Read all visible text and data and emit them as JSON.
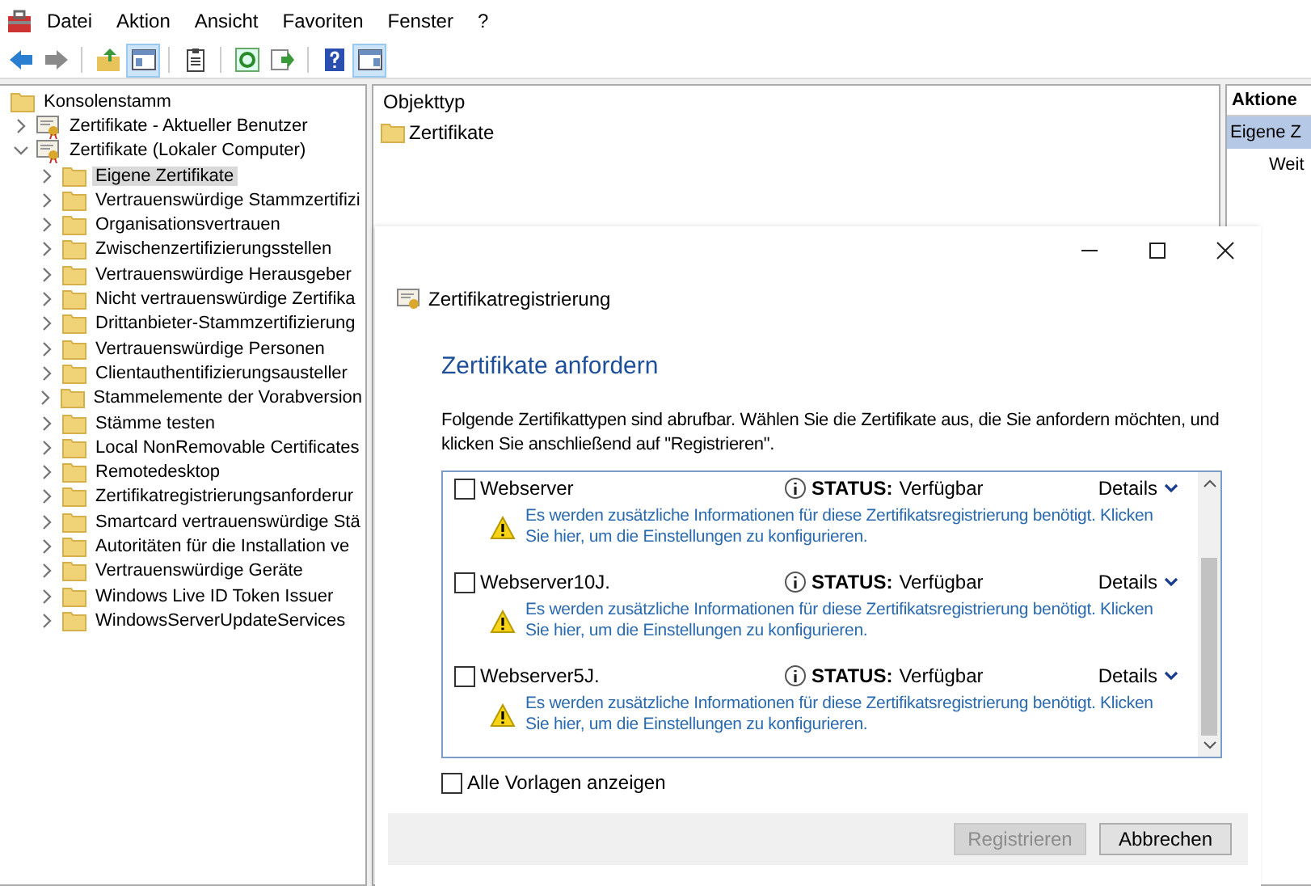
{
  "menu": [
    "Datei",
    "Aktion",
    "Ansicht",
    "Favoriten",
    "Fenster",
    "?"
  ],
  "toolbar": [
    [
      {
        "kind": "back",
        "pressed": false
      },
      {
        "kind": "forward",
        "pressed": false
      }
    ],
    [
      {
        "kind": "up",
        "pressed": false
      },
      {
        "kind": "tree",
        "pressed": true
      }
    ],
    [
      {
        "kind": "clipboard",
        "pressed": false
      }
    ],
    [
      {
        "kind": "refresh",
        "pressed": false
      },
      {
        "kind": "export",
        "pressed": false
      }
    ],
    [
      {
        "kind": "help",
        "pressed": false
      },
      {
        "kind": "actions",
        "pressed": true
      }
    ]
  ],
  "tree": [
    {
      "label": "Konsolenstamm",
      "kind": "root",
      "selected": false,
      "children": [
        {
          "label": "Zertifikate - Aktueller Benutzer",
          "kind": "store",
          "selected": false,
          "expanded": false
        },
        {
          "label": "Zertifikate (Lokaler Computer)",
          "kind": "store",
          "selected": false,
          "expanded": true,
          "children": [
            {
              "label": "Eigene Zertifikate",
              "kind": "folder",
              "selected": true,
              "expanded": false
            },
            {
              "label": "Vertrauenswürdige Stammzertifizi",
              "kind": "folder",
              "selected": false,
              "expanded": false
            },
            {
              "label": "Organisationsvertrauen",
              "kind": "folder",
              "selected": false,
              "expanded": false
            },
            {
              "label": "Zwischenzertifizierungsstellen",
              "kind": "folder",
              "selected": false,
              "expanded": false
            },
            {
              "label": "Vertrauenswürdige Herausgeber",
              "kind": "folder",
              "selected": false,
              "expanded": false
            },
            {
              "label": "Nicht vertrauenswürdige Zertifika",
              "kind": "folder",
              "selected": false,
              "expanded": false
            },
            {
              "label": "Drittanbieter-Stammzertifizierung",
              "kind": "folder",
              "selected": false,
              "expanded": false
            },
            {
              "label": "Vertrauenswürdige Personen",
              "kind": "folder",
              "selected": false,
              "expanded": false
            },
            {
              "label": "Clientauthentifizierungsausteller",
              "kind": "folder",
              "selected": false,
              "expanded": false
            },
            {
              "label": "Stammelemente der Vorabversion",
              "kind": "folder",
              "selected": false,
              "expanded": false
            },
            {
              "label": "Stämme testen",
              "kind": "folder",
              "selected": false,
              "expanded": false
            },
            {
              "label": "Local NonRemovable Certificates",
              "kind": "folder",
              "selected": false,
              "expanded": false
            },
            {
              "label": "Remotedesktop",
              "kind": "folder",
              "selected": false,
              "expanded": false
            },
            {
              "label": "Zertifikatregistrierungsanforderur",
              "kind": "folder",
              "selected": false,
              "expanded": false
            },
            {
              "label": "Smartcard vertrauenswürdige Stä",
              "kind": "folder",
              "selected": false,
              "expanded": false
            },
            {
              "label": "Autoritäten für die Installation ve",
              "kind": "folder",
              "selected": false,
              "expanded": false
            },
            {
              "label": "Vertrauenswürdige Geräte",
              "kind": "folder",
              "selected": false,
              "expanded": false
            },
            {
              "label": "Windows Live ID Token Issuer",
              "kind": "folder",
              "selected": false,
              "expanded": false
            },
            {
              "label": "WindowsServerUpdateServices",
              "kind": "folder",
              "selected": false,
              "expanded": false
            }
          ]
        }
      ]
    }
  ],
  "content": {
    "column": "Objekttyp",
    "items": [
      "Zertifikate"
    ]
  },
  "actions": {
    "title": "Aktione",
    "items": [
      {
        "label": "Eigene Z",
        "kind": "header",
        "selected": true
      },
      {
        "label": "Weit",
        "kind": "action",
        "selected": false
      }
    ]
  },
  "dialog": {
    "title": "Zertifikatregistrierung",
    "heading": "Zertifikate anfordern",
    "description": "Folgende Zertifikattypen sind abrufbar. Wählen Sie die Zertifikate aus, die Sie anfordern möchten, und klicken Sie anschließend auf \"Registrieren\".",
    "templates": [
      {
        "name": "Webserver",
        "checked": false,
        "status_label": "STATUS:",
        "status": "Verfügbar",
        "details": "Details",
        "warning": "Es werden zusätzliche Informationen für diese Zertifikatsregistrierung benötigt. Klicken Sie hier, um die Einstellungen zu konfigurieren."
      },
      {
        "name": "Webserver10J.",
        "checked": false,
        "status_label": "STATUS:",
        "status": "Verfügbar",
        "details": "Details",
        "warning": "Es werden zusätzliche Informationen für diese Zertifikatsregistrierung benötigt. Klicken Sie hier, um die Einstellungen zu konfigurieren."
      },
      {
        "name": "Webserver5J.",
        "checked": false,
        "status_label": "STATUS:",
        "status": "Verfügbar",
        "details": "Details",
        "warning": "Es werden zusätzliche Informationen für diese Zertifikatsregistrierung benötigt. Klicken Sie hier, um die Einstellungen zu konfigurieren."
      }
    ],
    "show_all": {
      "label": "Alle Vorlagen anzeigen",
      "checked": false
    },
    "buttons": [
      {
        "label": "Registrieren",
        "disabled": true
      },
      {
        "label": "Abbrechen",
        "disabled": false
      }
    ]
  }
}
